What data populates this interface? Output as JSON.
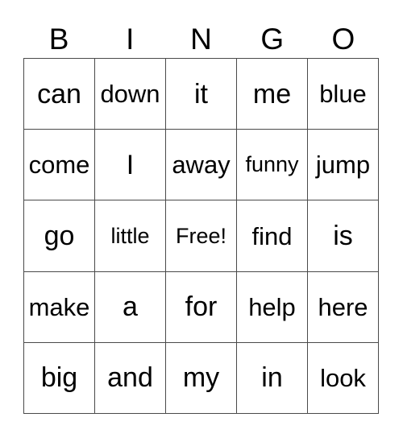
{
  "card": {
    "type": "bingo-card",
    "header": {
      "letters": [
        "B",
        "I",
        "N",
        "G",
        "O"
      ]
    },
    "grid": {
      "rows": 5,
      "columns": 5,
      "free_space": {
        "row": 2,
        "column": 2,
        "label": "Free!"
      },
      "cells": [
        [
          {
            "text": "can"
          },
          {
            "text": "down"
          },
          {
            "text": "it"
          },
          {
            "text": "me"
          },
          {
            "text": "blue"
          }
        ],
        [
          {
            "text": "come"
          },
          {
            "text": "I"
          },
          {
            "text": "away"
          },
          {
            "text": "funny"
          },
          {
            "text": "jump"
          }
        ],
        [
          {
            "text": "go"
          },
          {
            "text": "little"
          },
          {
            "text": "Free!"
          },
          {
            "text": "find"
          },
          {
            "text": "is"
          }
        ],
        [
          {
            "text": "make"
          },
          {
            "text": "a"
          },
          {
            "text": "for"
          },
          {
            "text": "help"
          },
          {
            "text": "here"
          }
        ],
        [
          {
            "text": "big"
          },
          {
            "text": "and"
          },
          {
            "text": "my"
          },
          {
            "text": "in"
          },
          {
            "text": "look"
          }
        ]
      ]
    },
    "colors": {
      "background": "#ffffff",
      "text": "#000000",
      "grid_line": "#4a4a4a"
    }
  }
}
